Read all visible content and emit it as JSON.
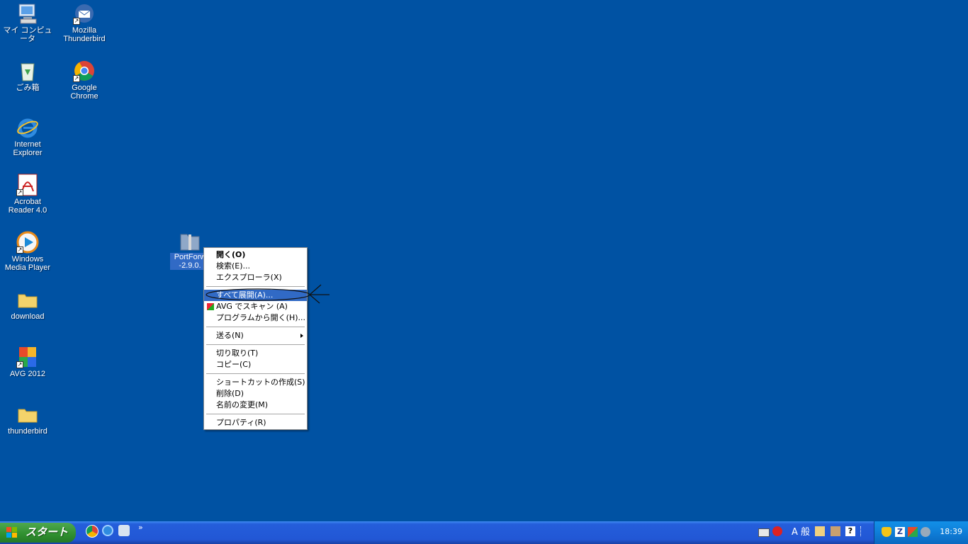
{
  "desktop": {
    "icons": [
      {
        "label1": "マイ コンピュータ",
        "label2": ""
      },
      {
        "label1": "Mozilla",
        "label2": "Thunderbird"
      },
      {
        "label1": "ごみ箱",
        "label2": ""
      },
      {
        "label1": "Google",
        "label2": "Chrome"
      },
      {
        "label1": "Internet",
        "label2": "Explorer"
      },
      {
        "label1": "Acrobat",
        "label2": "Reader 4.0"
      },
      {
        "label1": "Windows",
        "label2": "Media Player"
      },
      {
        "label1": "download",
        "label2": ""
      },
      {
        "label1": "AVG 2012",
        "label2": ""
      },
      {
        "label1": "thunderbird",
        "label2": ""
      }
    ],
    "selected_file": {
      "label1": "PortForw",
      "label2": "-2.9.0."
    }
  },
  "context_menu": {
    "open": "開く(O)",
    "search": "検索(E)...",
    "explorer": "エクスプローラ(X)",
    "extract_all": "すべて展開(A)...",
    "avg_scan": "AVG でスキャン (A)",
    "open_with": "プログラムから開く(H)...",
    "send_to": "送る(N)",
    "cut": "切り取り(T)",
    "copy": "コピー(C)",
    "create_shortcut": "ショートカットの作成(S)",
    "delete": "削除(D)",
    "rename": "名前の変更(M)",
    "properties": "プロパティ(R)"
  },
  "taskbar": {
    "start_label": "スタート",
    "chevron": "»",
    "ime": "A 般",
    "clock": "18:39"
  },
  "colors": {
    "desktop": "#0052a3",
    "highlight": "#316ac5"
  }
}
